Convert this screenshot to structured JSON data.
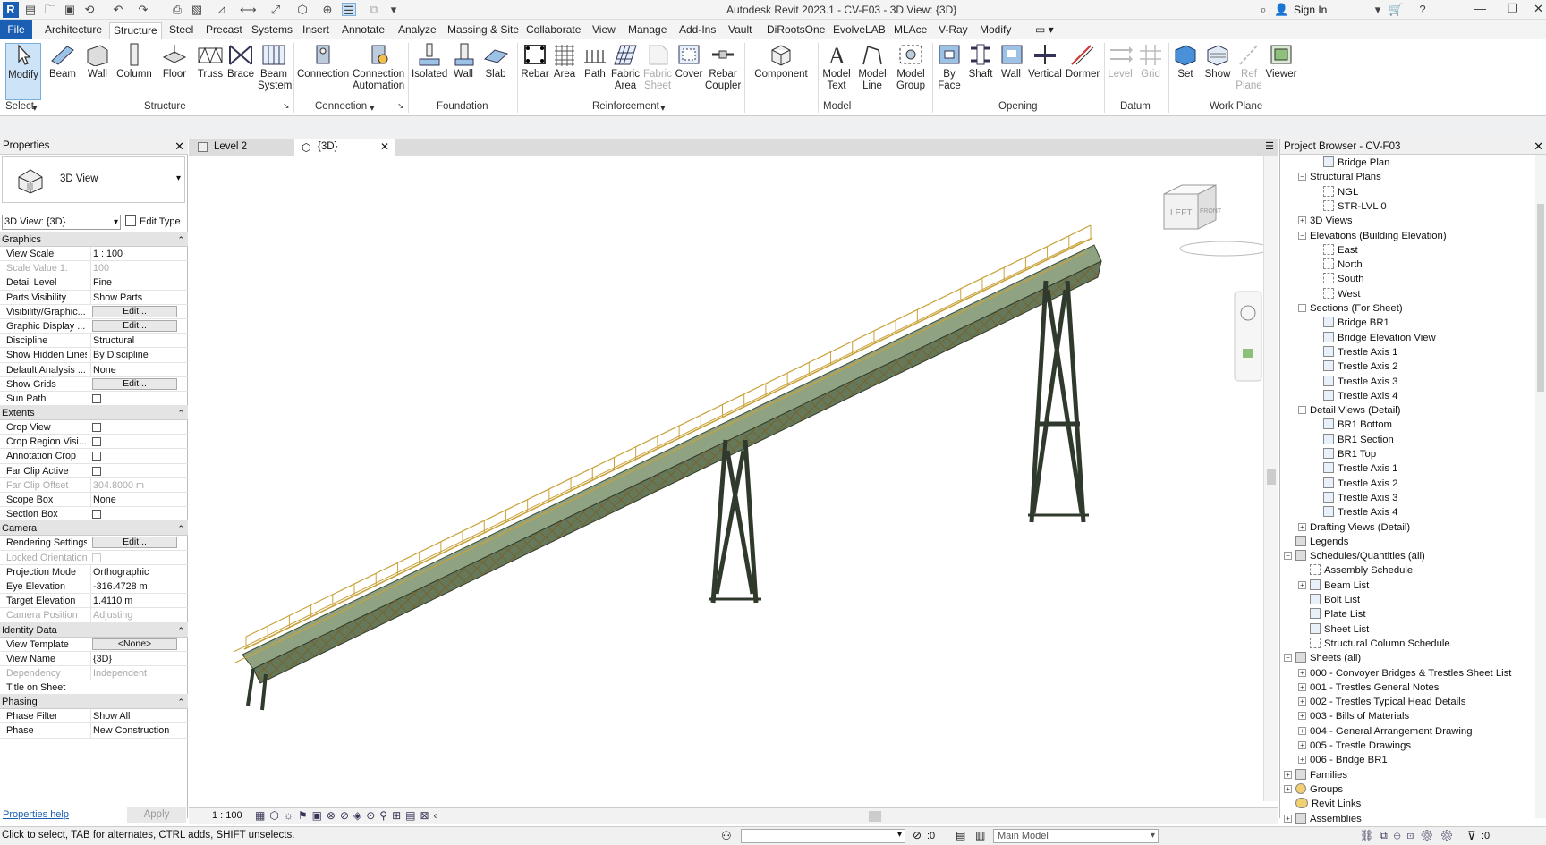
{
  "app": {
    "logo_letter": "R",
    "title": "Autodesk Revit 2023.1 - CV-F03 - 3D View: {3D}",
    "sign_in": "Sign In",
    "window_controls": [
      "—",
      "❐",
      "✕"
    ]
  },
  "tabs": {
    "file": "File",
    "items": [
      "Architecture",
      "Structure",
      "Steel",
      "Precast",
      "Systems",
      "Insert",
      "Annotate",
      "Analyze",
      "Massing & Site",
      "Collaborate",
      "View",
      "Manage",
      "Add-Ins",
      "Vault",
      "DiRootsOne",
      "EvolveLAB",
      "MLAce",
      "V-Ray",
      "Modify"
    ],
    "active": "Structure"
  },
  "ribbon": {
    "buttons": [
      {
        "id": "modify",
        "l1": "Modify",
        "l2": ""
      },
      {
        "id": "beam",
        "l1": "Beam",
        "l2": ""
      },
      {
        "id": "wall",
        "l1": "Wall",
        "l2": ""
      },
      {
        "id": "column",
        "l1": "Column",
        "l2": ""
      },
      {
        "id": "floor",
        "l1": "Floor",
        "l2": ""
      },
      {
        "id": "truss",
        "l1": "Truss",
        "l2": ""
      },
      {
        "id": "brace",
        "l1": "Brace",
        "l2": ""
      },
      {
        "id": "beam-system",
        "l1": "Beam",
        "l2": "System"
      },
      {
        "id": "connection",
        "l1": "Connection",
        "l2": ""
      },
      {
        "id": "connection-automation",
        "l1": "Connection",
        "l2": "Automation"
      },
      {
        "id": "isolated",
        "l1": "Isolated",
        "l2": ""
      },
      {
        "id": "foundation-wall",
        "l1": "Wall",
        "l2": ""
      },
      {
        "id": "slab",
        "l1": "Slab",
        "l2": ""
      },
      {
        "id": "rebar",
        "l1": "Rebar",
        "l2": ""
      },
      {
        "id": "area",
        "l1": "Area",
        "l2": ""
      },
      {
        "id": "path",
        "l1": "Path",
        "l2": ""
      },
      {
        "id": "fabric-area",
        "l1": "Fabric",
        "l2": "Area"
      },
      {
        "id": "fabric-sheet",
        "l1": "Fabric",
        "l2": "Sheet"
      },
      {
        "id": "cover",
        "l1": "Cover",
        "l2": ""
      },
      {
        "id": "rebar-coupler",
        "l1": "Rebar",
        "l2": "Coupler"
      },
      {
        "id": "component",
        "l1": "Component",
        "l2": ""
      },
      {
        "id": "model-text",
        "l1": "Model",
        "l2": "Text"
      },
      {
        "id": "model-line",
        "l1": "Model",
        "l2": "Line"
      },
      {
        "id": "model-group",
        "l1": "Model",
        "l2": "Group"
      },
      {
        "id": "by-face",
        "l1": "By",
        "l2": "Face"
      },
      {
        "id": "shaft",
        "l1": "Shaft",
        "l2": ""
      },
      {
        "id": "opening-wall",
        "l1": "Wall",
        "l2": ""
      },
      {
        "id": "vertical",
        "l1": "Vertical",
        "l2": ""
      },
      {
        "id": "dormer",
        "l1": "Dormer",
        "l2": ""
      },
      {
        "id": "level",
        "l1": "Level",
        "l2": ""
      },
      {
        "id": "grid",
        "l1": "Grid",
        "l2": ""
      },
      {
        "id": "set",
        "l1": "Set",
        "l2": ""
      },
      {
        "id": "show",
        "l1": "Show",
        "l2": ""
      },
      {
        "id": "ref-plane",
        "l1": "Ref",
        "l2": "Plane"
      },
      {
        "id": "viewer",
        "l1": "Viewer",
        "l2": ""
      }
    ],
    "panels": [
      "Select",
      "Structure",
      "Connection",
      "Foundation",
      "Reinforcement",
      "Model",
      "Opening",
      "Datum",
      "Work Plane"
    ]
  },
  "properties": {
    "title": "Properties",
    "type_name": "3D View",
    "view_selector": "3D View: {3D}",
    "edit_type": "Edit Type",
    "categories": [
      {
        "name": "Graphics",
        "rows": [
          {
            "k": "View Scale",
            "v": "1 : 100",
            "kind": "text"
          },
          {
            "k": "Scale Value    1:",
            "v": "100",
            "kind": "grey"
          },
          {
            "k": "Detail Level",
            "v": "Fine",
            "kind": "text"
          },
          {
            "k": "Parts Visibility",
            "v": "Show Parts",
            "kind": "text"
          },
          {
            "k": "Visibility/Graphic...",
            "v": "Edit...",
            "kind": "button"
          },
          {
            "k": "Graphic Display ...",
            "v": "Edit...",
            "kind": "button"
          },
          {
            "k": "Discipline",
            "v": "Structural",
            "kind": "text"
          },
          {
            "k": "Show Hidden Lines",
            "v": "By Discipline",
            "kind": "text"
          },
          {
            "k": "Default Analysis ...",
            "v": "None",
            "kind": "text"
          },
          {
            "k": "Show Grids",
            "v": "Edit...",
            "kind": "button"
          },
          {
            "k": "Sun Path",
            "v": "",
            "kind": "check"
          }
        ]
      },
      {
        "name": "Extents",
        "rows": [
          {
            "k": "Crop View",
            "v": "",
            "kind": "check"
          },
          {
            "k": "Crop Region Visi...",
            "v": "",
            "kind": "check"
          },
          {
            "k": "Annotation Crop",
            "v": "",
            "kind": "check"
          },
          {
            "k": "Far Clip Active",
            "v": "",
            "kind": "check"
          },
          {
            "k": "Far Clip Offset",
            "v": "304.8000 m",
            "kind": "grey"
          },
          {
            "k": "Scope Box",
            "v": "None",
            "kind": "text"
          },
          {
            "k": "Section Box",
            "v": "",
            "kind": "check"
          }
        ]
      },
      {
        "name": "Camera",
        "rows": [
          {
            "k": "Rendering Settings",
            "v": "Edit...",
            "kind": "button"
          },
          {
            "k": "Locked Orientation",
            "v": "",
            "kind": "greycheck"
          },
          {
            "k": "Projection Mode",
            "v": "Orthographic",
            "kind": "text"
          },
          {
            "k": "Eye Elevation",
            "v": "-316.4728 m",
            "kind": "text"
          },
          {
            "k": "Target Elevation",
            "v": "1.4110 m",
            "kind": "text"
          },
          {
            "k": "Camera Position",
            "v": "Adjusting",
            "kind": "grey"
          }
        ]
      },
      {
        "name": "Identity Data",
        "rows": [
          {
            "k": "View Template",
            "v": "<None>",
            "kind": "button"
          },
          {
            "k": "View Name",
            "v": "{3D}",
            "kind": "text"
          },
          {
            "k": "Dependency",
            "v": "Independent",
            "kind": "grey"
          },
          {
            "k": "Title on Sheet",
            "v": "",
            "kind": "text"
          }
        ]
      },
      {
        "name": "Phasing",
        "rows": [
          {
            "k": "Phase Filter",
            "v": "Show All",
            "kind": "text"
          },
          {
            "k": "Phase",
            "v": "New Construction",
            "kind": "text"
          }
        ]
      }
    ],
    "help_link": "Properties help",
    "apply": "Apply"
  },
  "view": {
    "tabs": [
      "Level 2",
      "{3D}"
    ],
    "cube_left": "LEFT",
    "cube_front": "FRONT",
    "scale": "1 : 100"
  },
  "browser": {
    "title": "Project Browser - CV-F03",
    "items": [
      {
        "t": "Bridge Plan",
        "lvl": 3,
        "exp": "",
        "icon": "view"
      },
      {
        "t": "Structural Plans",
        "lvl": 2,
        "exp": "−",
        "icon": ""
      },
      {
        "t": "NGL",
        "lvl": 3,
        "exp": "",
        "icon": "plan"
      },
      {
        "t": "STR-LVL 0",
        "lvl": 3,
        "exp": "",
        "icon": "plan"
      },
      {
        "t": "3D Views",
        "lvl": 2,
        "exp": "+",
        "icon": ""
      },
      {
        "t": "Elevations (Building Elevation)",
        "lvl": 2,
        "exp": "−",
        "icon": ""
      },
      {
        "t": "East",
        "lvl": 3,
        "exp": "",
        "icon": "plan"
      },
      {
        "t": "North",
        "lvl": 3,
        "exp": "",
        "icon": "plan"
      },
      {
        "t": "South",
        "lvl": 3,
        "exp": "",
        "icon": "plan"
      },
      {
        "t": "West",
        "lvl": 3,
        "exp": "",
        "icon": "plan"
      },
      {
        "t": "Sections (For Sheet)",
        "lvl": 2,
        "exp": "−",
        "icon": ""
      },
      {
        "t": "Bridge BR1",
        "lvl": 3,
        "exp": "",
        "icon": "view"
      },
      {
        "t": "Bridge Elevation View",
        "lvl": 3,
        "exp": "",
        "icon": "view"
      },
      {
        "t": "Trestle Axis 1",
        "lvl": 3,
        "exp": "",
        "icon": "view"
      },
      {
        "t": "Trestle Axis 2",
        "lvl": 3,
        "exp": "",
        "icon": "view"
      },
      {
        "t": "Trestle Axis 3",
        "lvl": 3,
        "exp": "",
        "icon": "view"
      },
      {
        "t": "Trestle Axis 4",
        "lvl": 3,
        "exp": "",
        "icon": "view"
      },
      {
        "t": "Detail Views (Detail)",
        "lvl": 2,
        "exp": "−",
        "icon": ""
      },
      {
        "t": "BR1 Bottom",
        "lvl": 3,
        "exp": "",
        "icon": "view"
      },
      {
        "t": "BR1 Section",
        "lvl": 3,
        "exp": "",
        "icon": "view"
      },
      {
        "t": "BR1 Top",
        "lvl": 3,
        "exp": "",
        "icon": "view"
      },
      {
        "t": "Trestle Axis 1",
        "lvl": 3,
        "exp": "",
        "icon": "view"
      },
      {
        "t": "Trestle Axis 2",
        "lvl": 3,
        "exp": "",
        "icon": "view"
      },
      {
        "t": "Trestle Axis 3",
        "lvl": 3,
        "exp": "",
        "icon": "view"
      },
      {
        "t": "Trestle Axis 4",
        "lvl": 3,
        "exp": "",
        "icon": "view"
      },
      {
        "t": "Drafting Views (Detail)",
        "lvl": 2,
        "exp": "+",
        "icon": ""
      },
      {
        "t": "Legends",
        "lvl": 1,
        "exp": "",
        "icon": "grid"
      },
      {
        "t": "Schedules/Quantities (all)",
        "lvl": 1,
        "exp": "−",
        "icon": "grid"
      },
      {
        "t": "Assembly Schedule",
        "lvl": 2,
        "exp": "",
        "icon": "plan"
      },
      {
        "t": "Beam List",
        "lvl": 2,
        "exp": "+",
        "icon": "view"
      },
      {
        "t": "Bolt List",
        "lvl": 2,
        "exp": "",
        "icon": "view"
      },
      {
        "t": "Plate List",
        "lvl": 2,
        "exp": "",
        "icon": "view"
      },
      {
        "t": "Sheet List",
        "lvl": 2,
        "exp": "",
        "icon": "view"
      },
      {
        "t": "Structural Column Schedule",
        "lvl": 2,
        "exp": "",
        "icon": "plan"
      },
      {
        "t": "Sheets (all)",
        "lvl": 1,
        "exp": "−",
        "icon": "grid"
      },
      {
        "t": "000 - Convoyer Bridges & Trestles Sheet List",
        "lvl": 2,
        "exp": "+",
        "icon": ""
      },
      {
        "t": "001 - Trestles General Notes",
        "lvl": 2,
        "exp": "+",
        "icon": ""
      },
      {
        "t": "002 - Trestles Typical Head Details",
        "lvl": 2,
        "exp": "+",
        "icon": ""
      },
      {
        "t": "003 - Bills of Materials",
        "lvl": 2,
        "exp": "+",
        "icon": ""
      },
      {
        "t": "004 - General Arrangement Drawing",
        "lvl": 2,
        "exp": "+",
        "icon": ""
      },
      {
        "t": "005 - Trestle Drawings",
        "lvl": 2,
        "exp": "+",
        "icon": ""
      },
      {
        "t": "006 - Bridge BR1",
        "lvl": 2,
        "exp": "+",
        "icon": ""
      },
      {
        "t": "Families",
        "lvl": 1,
        "exp": "+",
        "icon": "grid"
      },
      {
        "t": "Groups",
        "lvl": 1,
        "exp": "+",
        "icon": "group"
      },
      {
        "t": "Revit Links",
        "lvl": 1,
        "exp": "",
        "icon": "link"
      },
      {
        "t": "Assemblies",
        "lvl": 1,
        "exp": "+",
        "icon": "grid"
      }
    ]
  },
  "status": {
    "hint": "Click to select, TAB for alternates, CTRL adds, SHIFT unselects.",
    "workset_count": ":0",
    "model": "Main Model",
    "filter_count": ":0"
  },
  "colors": {
    "accent": "#1a5fb4",
    "steel": "#7a9a6a",
    "rail": "#c9a23a",
    "trestle": "#2f3a2c"
  }
}
